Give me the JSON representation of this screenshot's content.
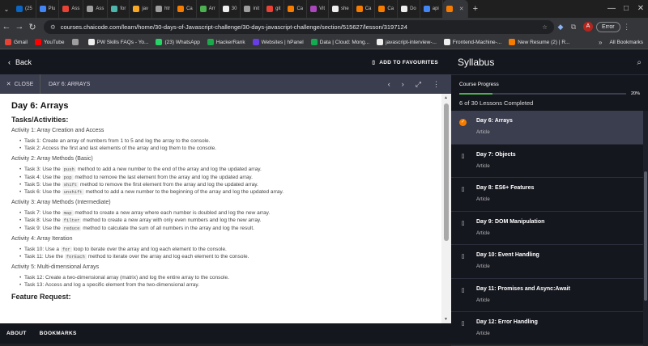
{
  "browser": {
    "tabs": [
      {
        "label": "(25",
        "color": "#0a66c2"
      },
      {
        "label": "Plu",
        "color": "#4285f4"
      },
      {
        "label": "Ass",
        "color": "#e94235"
      },
      {
        "label": "Ass",
        "color": "#9e9e9e"
      },
      {
        "label": "for",
        "color": "#4db6ac"
      },
      {
        "label": "jav",
        "color": "#f9a825"
      },
      {
        "label": "htr",
        "color": "#9e9e9e"
      },
      {
        "label": "Ca",
        "color": "#f57c00"
      },
      {
        "label": "Arr",
        "color": "#4caf50"
      },
      {
        "label": "30",
        "color": "#eeeeee"
      },
      {
        "label": "init",
        "color": "#9e9e9e"
      },
      {
        "label": "git",
        "color": "#e94235"
      },
      {
        "label": "Ca",
        "color": "#f57c00"
      },
      {
        "label": "Vit",
        "color": "#ab47bc"
      },
      {
        "label": "she",
        "color": "#eeeeee"
      },
      {
        "label": "Ca",
        "color": "#f57c00"
      },
      {
        "label": "Ca",
        "color": "#f57c00"
      },
      {
        "label": "Do",
        "color": "#eeeeee"
      },
      {
        "label": "api",
        "color": "#4285f4"
      },
      {
        "label": "",
        "color": "#f57c00",
        "active": true
      }
    ],
    "new_tab": "+",
    "window_controls": [
      "—",
      "□",
      "✕"
    ],
    "url": "courses.chaicode.com/learn/home/30-days-of-Javascript-challenge/30-days-javascript-challenge/section/515627/lesson/3197124",
    "error_button": "Error",
    "avatar_letter": "A",
    "bookmarks": [
      {
        "label": "Gmail",
        "color": "#e94235"
      },
      {
        "label": "YouTube",
        "color": "#ff0000"
      },
      {
        "label": "",
        "color": "#9e9e9e"
      },
      {
        "label": "PW Skills FAQs - Yo...",
        "color": "#eeeeee"
      },
      {
        "label": "(23) WhatsApp",
        "color": "#25d366"
      },
      {
        "label": "HackerRank",
        "color": "#1ba94c"
      },
      {
        "label": "Websites | hPanel",
        "color": "#673de6"
      },
      {
        "label": "Data | Cloud: Mong...",
        "color": "#13aa52"
      },
      {
        "label": "javascript-interview-...",
        "color": "#eeeeee"
      },
      {
        "label": "Frontend-Machine-...",
        "color": "#eeeeee"
      },
      {
        "label": "New Resume (2) | R...",
        "color": "#f57c00"
      }
    ],
    "bookmarks_more": "»",
    "all_bookmarks": "All Bookmarks"
  },
  "topbar": {
    "back_label": "Back",
    "favourite_label": "ADD TO FAVOURITES"
  },
  "lessonbar": {
    "close_label": "CLOSE",
    "title": "DAY 6: ARRAYS"
  },
  "content": {
    "title": "Day 6: Arrays",
    "tasks_heading": "Tasks/Activities:",
    "activities": [
      {
        "heading": "Activity 1: Array Creation and Access",
        "tasks": [
          {
            "pre": "Task 1: Create an array of numbers from 1 to 5 and log the array to the console.",
            "code": "",
            "post": ""
          },
          {
            "pre": "Task 2: Access the first and last elements of the array and log them to the console.",
            "code": "",
            "post": ""
          }
        ]
      },
      {
        "heading": "Activity 2: Array Methods (Basic)",
        "tasks": [
          {
            "pre": "Task 3: Use the ",
            "code": "push",
            "post": " method to add a new number to the end of the array and log the updated array."
          },
          {
            "pre": "Task 4: Use the ",
            "code": "pop",
            "post": " method to remove the last element from the array and log the updated array."
          },
          {
            "pre": "Task 5: Use the ",
            "code": "shift",
            "post": " method to remove the first element from the array and log the updated array."
          },
          {
            "pre": "Task 6: Use the ",
            "code": "unshift",
            "post": " method to add a new number to the beginning of the array and log the updated array."
          }
        ]
      },
      {
        "heading": "Activity 3: Array Methods (Intermediate)",
        "tasks": [
          {
            "pre": "Task 7: Use the ",
            "code": "map",
            "post": " method to create a new array where each number is doubled and log the new array."
          },
          {
            "pre": "Task 8: Use the ",
            "code": "filter",
            "post": " method to create a new array with only even numbers and log the new array."
          },
          {
            "pre": "Task 9: Use the ",
            "code": "reduce",
            "post": " method to calculate the sum of all numbers in the array and log the result."
          }
        ]
      },
      {
        "heading": "Activity 4: Array Iteration",
        "tasks": [
          {
            "pre": "Task 10: Use a ",
            "code": "for",
            "post": " loop to iterate over the array and log each element to the console."
          },
          {
            "pre": "Task 11: Use the ",
            "code": "forEach",
            "post": " method to iterate over the array and log each element to the console."
          }
        ]
      },
      {
        "heading": "Activity 5: Multi-dimensional Arrays",
        "tasks": [
          {
            "pre": "Task 12: Create a two-dimensional array (matrix) and log the entire array to the console.",
            "code": "",
            "post": ""
          },
          {
            "pre": "Task 13: Access and log a specific element from the two-dimensional array.",
            "code": "",
            "post": ""
          }
        ]
      }
    ],
    "feature_heading": "Feature Request:"
  },
  "footer": {
    "about": "ABOUT",
    "bookmarks": "BOOKMARKS"
  },
  "sidebar": {
    "title": "Syllabus",
    "progress_label": "Course Progress",
    "progress_value": 0.2,
    "progress_pct": "20%",
    "progress_count": "6 of 30 Lessons Completed",
    "lessons": [
      {
        "name": "Day 6: Arrays",
        "kind": "Article",
        "active": true,
        "done": true
      },
      {
        "name": "Day 7: Objects",
        "kind": "Article"
      },
      {
        "name": "Day 8: ES6+ Features",
        "kind": "Article"
      },
      {
        "name": "Day 9: DOM Manipulation",
        "kind": "Article"
      },
      {
        "name": "Day 10: Event Handling",
        "kind": "Article"
      },
      {
        "name": "Day 11: Promises and Async:Await",
        "kind": "Article"
      },
      {
        "name": "Day 12: Error Handling",
        "kind": "Article"
      }
    ]
  },
  "colors": {
    "accent": "#f57c00",
    "progress": "#4caf50",
    "active_lesson_bg": "#3b3e4f"
  }
}
